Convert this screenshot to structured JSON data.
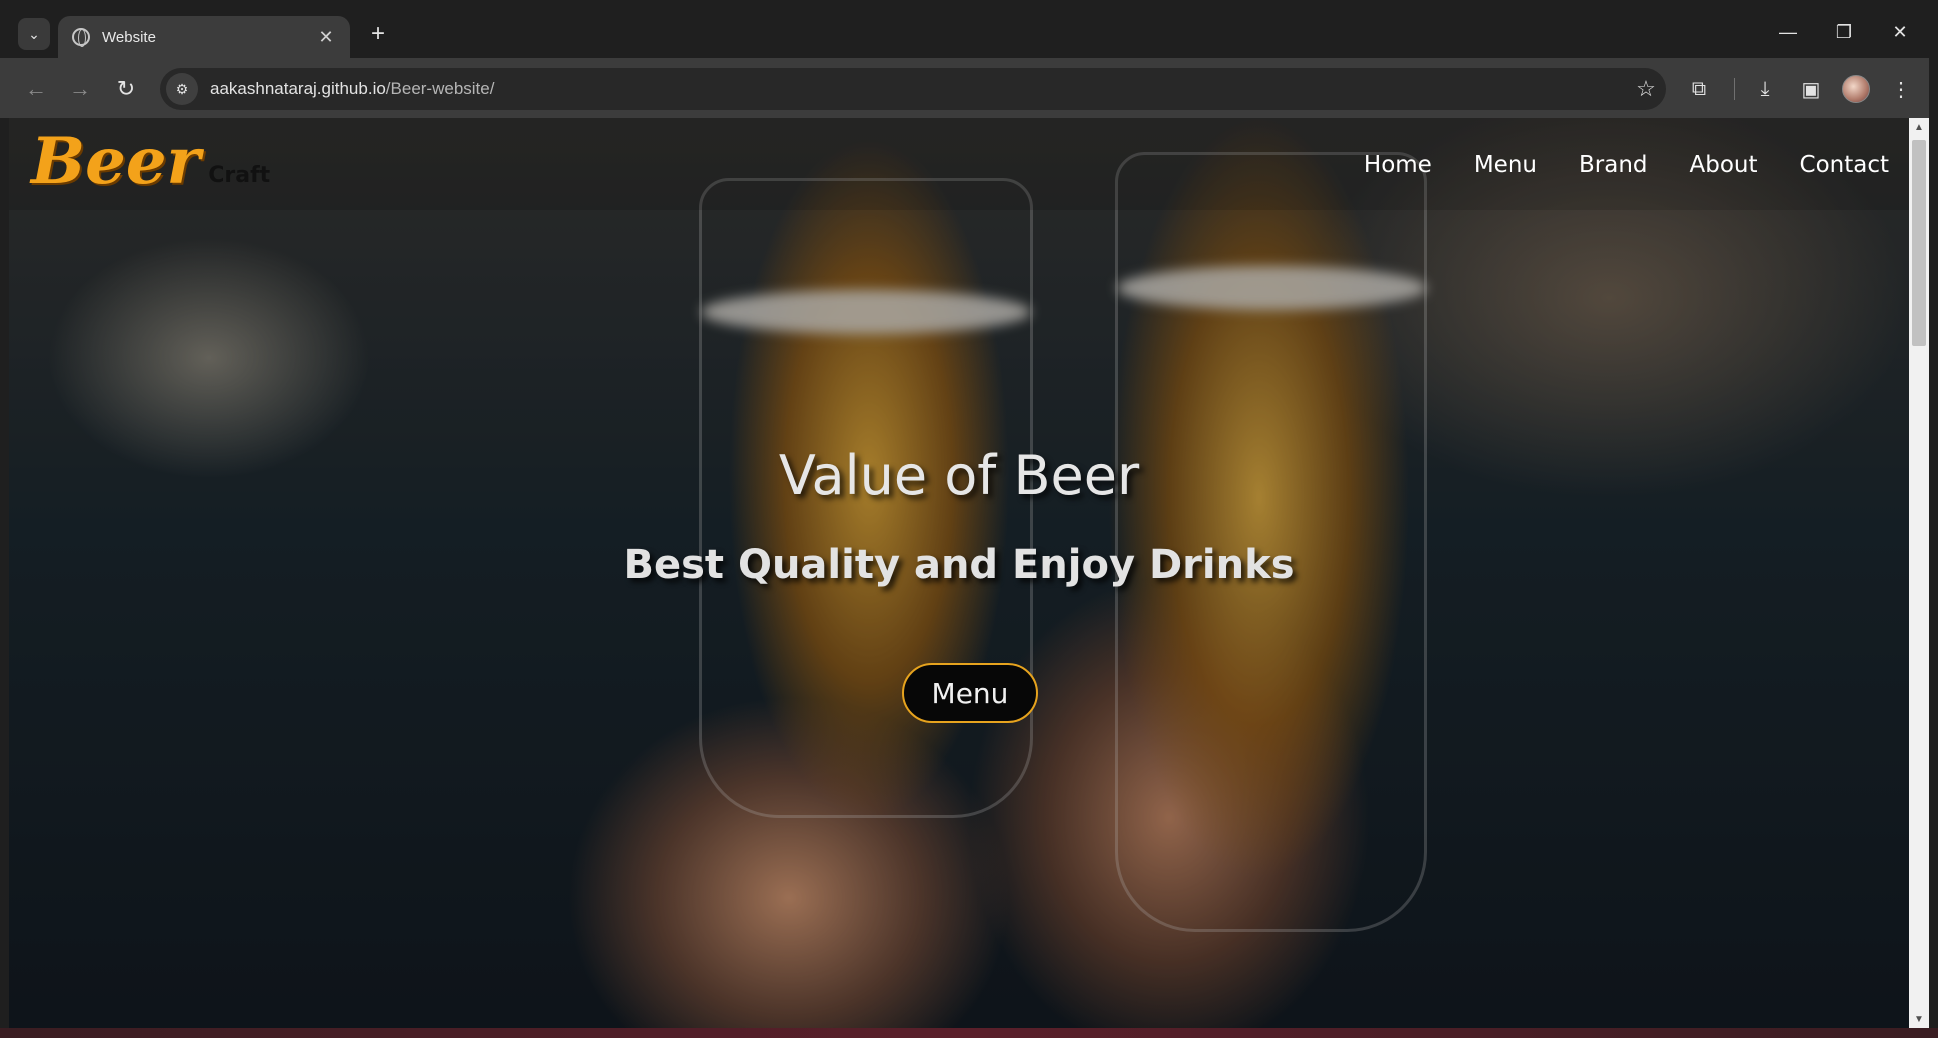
{
  "browser": {
    "tab_title": "Website",
    "tab_close": "✕",
    "new_tab": "+",
    "url_host": "aakashnataraj.github.io",
    "url_path": "/Beer-website/",
    "window_controls": {
      "minimize": "—",
      "restore": "❐",
      "close": "✕"
    }
  },
  "site": {
    "logo_main": "Beer",
    "logo_sub": "Craft",
    "nav": [
      "Home",
      "Menu",
      "Brand",
      "About",
      "Contact"
    ],
    "hero_title": "Value of Beer",
    "hero_subtitle": "Best Quality and Enjoy Drinks",
    "hero_button": "Menu"
  },
  "colors": {
    "logo_orange": "#f3a21a",
    "button_border": "#e6a31e",
    "chrome_dark": "#1f1f1f",
    "toolbar": "#3c3c3c"
  },
  "icons": [
    "tab-search-icon",
    "globe-icon",
    "back-arrow-icon",
    "forward-arrow-icon",
    "reload-icon",
    "site-info-icon",
    "bookmark-star-icon",
    "extensions-icon",
    "download-icon",
    "side-panel-icon",
    "profile-avatar-icon",
    "more-menu-icon"
  ]
}
